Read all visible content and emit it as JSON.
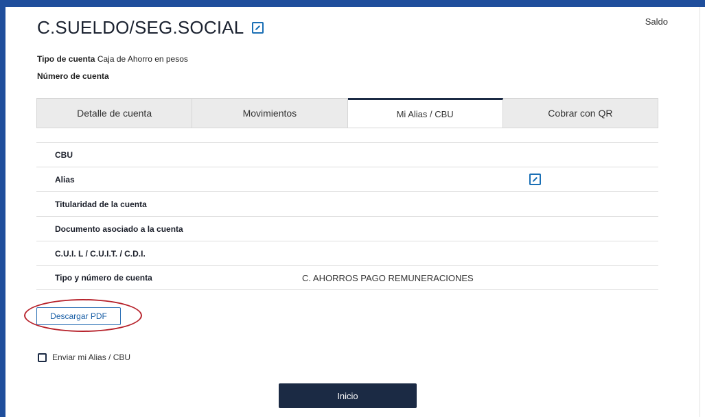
{
  "header": {
    "title": "C.SUELDO/SEG.SOCIAL",
    "saldo_label": "Saldo"
  },
  "account_info": {
    "tipo_label": "Tipo de cuenta",
    "tipo_value": "Caja de Ahorro en pesos",
    "numero_label": "Número de cuenta"
  },
  "tabs": [
    {
      "label": "Detalle de cuenta",
      "active": false
    },
    {
      "label": "Movimientos",
      "active": false
    },
    {
      "label": "Mi Alias / CBU",
      "active": true
    },
    {
      "label": "Cobrar con QR",
      "active": false
    }
  ],
  "details": {
    "rows": [
      {
        "label": "CBU",
        "value": ""
      },
      {
        "label": "Alias",
        "value": ""
      },
      {
        "label": "Titularidad de la cuenta",
        "value": ""
      },
      {
        "label": "Documento asociado a la cuenta",
        "value": ""
      },
      {
        "label": "C.U.I. L / C.U.I.T. / C.D.I.",
        "value": ""
      },
      {
        "label": "Tipo y número de cuenta",
        "value": "C. AHORROS PAGO REMUNERACIONES"
      }
    ]
  },
  "actions": {
    "download_pdf": "Descargar PDF",
    "send_alias_label": "Enviar mi Alias / CBU",
    "inicio": "Inicio"
  },
  "icons": {
    "edit": "pencil-edit-icon"
  },
  "colors": {
    "frame": "#1f4e9c",
    "primary": "#1b2a44",
    "link": "#1a6fb5",
    "highlight_circle": "#b7232c"
  }
}
